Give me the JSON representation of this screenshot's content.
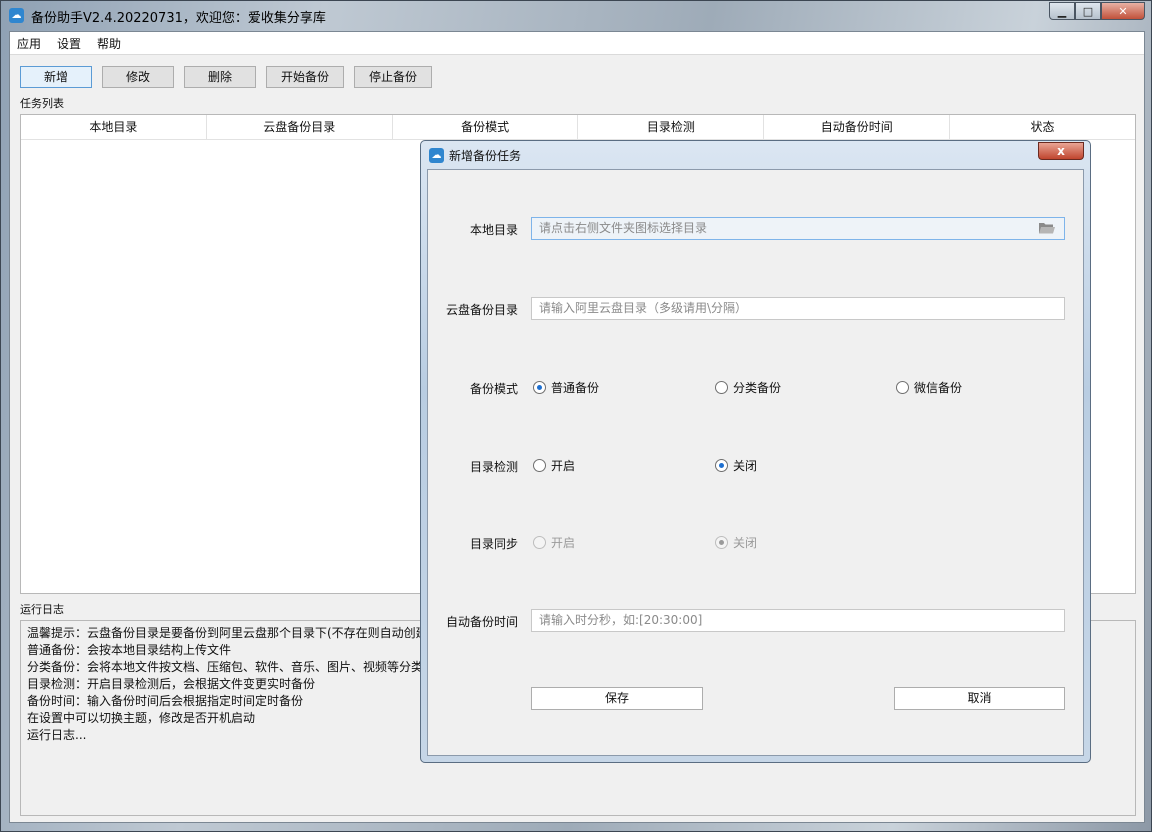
{
  "window": {
    "title": "备份助手V2.4.20220731，欢迎您：爱收集分享库",
    "icon": "cloud-icon",
    "controls": {
      "minimize": "minimize-icon",
      "maximize": "maximize-icon",
      "close": "close-icon"
    }
  },
  "menu": [
    "应用",
    "设置",
    "帮助"
  ],
  "toolbar": [
    "新增",
    "修改",
    "删除",
    "开始备份",
    "停止备份"
  ],
  "task_list": {
    "label": "任务列表",
    "columns": [
      "本地目录",
      "云盘备份目录",
      "备份模式",
      "目录检测",
      "自动备份时间",
      "状态"
    ]
  },
  "log": {
    "label": "运行日志",
    "lines": [
      "温馨提示：云盘备份目录是要备份到阿里云盘那个目录下(不存在则自动创建",
      "普通备份：会按本地目录结构上传文件",
      "分类备份：会将本地文件按文档、压缩包、软件、音乐、图片、视频等分类",
      "目录检测：开启目录检测后，会根据文件变更实时备份",
      "备份时间：输入备份时间后会根据指定时间定时备份",
      "在设置中可以切换主题，修改是否开机启动",
      "运行日志..."
    ]
  },
  "dialog": {
    "title": "新增备份任务",
    "local_dir": {
      "label": "本地目录",
      "placeholder": "请点击右侧文件夹图标选择目录",
      "icon": "folder-icon"
    },
    "cloud_dir": {
      "label": "云盘备份目录",
      "placeholder": "请输入阿里云盘目录（多级请用\\分隔）"
    },
    "backup_mode": {
      "label": "备份模式",
      "options": [
        "普通备份",
        "分类备份",
        "微信备份"
      ],
      "selected": "普通备份"
    },
    "dir_check": {
      "label": "目录检测",
      "options": [
        "开启",
        "关闭"
      ],
      "selected": "关闭"
    },
    "dir_sync": {
      "label": "目录同步",
      "options": [
        "开启",
        "关闭"
      ],
      "selected": "关闭",
      "disabled": true
    },
    "auto_time": {
      "label": "自动备份时间",
      "placeholder": "请输入时分秒，如:[20:30:00]"
    },
    "save_label": "保存",
    "cancel_label": "取消",
    "close_label": "x"
  }
}
